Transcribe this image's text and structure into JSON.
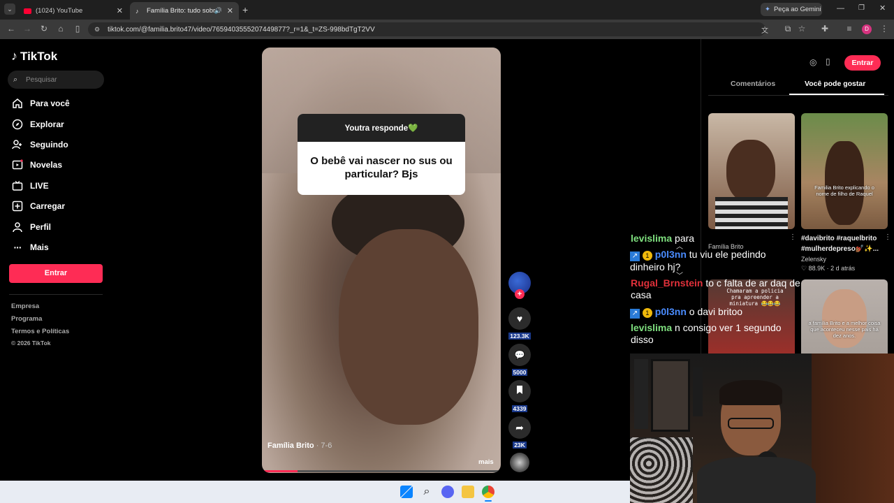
{
  "browser": {
    "tabs": [
      {
        "label": "(1024) YouTube"
      },
      {
        "label": "Família Brito: tudo sobre Ra"
      }
    ],
    "gemini_label": "Peça ao Gemini",
    "url": "tiktok.com/@familia.brito47/video/7659403555207449877?_r=1&_t=ZS-998bdTgT2VV",
    "profile_letter": "D"
  },
  "sidebar": {
    "logo": "TikTok",
    "search_placeholder": "Pesquisar",
    "items": [
      {
        "label": "Para você",
        "icon": "home-icon"
      },
      {
        "label": "Explorar",
        "icon": "compass-icon"
      },
      {
        "label": "Seguindo",
        "icon": "following-icon"
      },
      {
        "label": "Novelas",
        "icon": "novelas-icon"
      },
      {
        "label": "LIVE",
        "icon": "live-icon"
      },
      {
        "label": "Carregar",
        "icon": "upload-icon"
      },
      {
        "label": "Perfil",
        "icon": "profile-icon"
      },
      {
        "label": "Mais",
        "icon": "more-icon"
      }
    ],
    "login_button": "Entrar",
    "footer": [
      "Empresa",
      "Programa",
      "Termos e Políticas",
      "© 2026 TikTok"
    ]
  },
  "video": {
    "question_header": "Youtra responde💚",
    "question_text": "O bebê vai nascer no sus ou particular? Bjs",
    "author": "Família Brito",
    "date": "· 7-6",
    "more": "mais",
    "progress": 0.15
  },
  "actions": {
    "likes": "123.3K",
    "comments": "5000",
    "saves": "4339",
    "shares": "23K"
  },
  "right_panel": {
    "login_button": "Entrar",
    "tabs": [
      "Comentários",
      "Você pode gostar"
    ],
    "cards": [
      {
        "author": "Família Brito"
      },
      {
        "overlay": "Familia Brito explicando o nome de filho de Raquel",
        "title": "#davibrito #raquelbrito #mulherdepreso💅🏾✨...",
        "author": "Zelensky",
        "likes": "88.9K",
        "time": "2 d atrás"
      },
      {
        "overlay": "Chamaram a policia pra apreender a miniatura 😂😂😂"
      },
      {
        "overlay": "a família Brito e a melhor coisa que aconteceu nesse pais há dez anos."
      }
    ]
  },
  "chat": [
    {
      "user": "levislima",
      "text": "para",
      "color": "#7fe07f"
    },
    {
      "user": "p0l3nn",
      "text": "tu viu ele pedindo dinheiro hj?",
      "color": "#4a8cff"
    },
    {
      "user": "Rugal_Brnstein",
      "text": "to c falta de ar daq de casa",
      "color": "#e0303a"
    },
    {
      "user": "p0l3nn",
      "text": "o davi britoo",
      "color": "#4a8cff"
    },
    {
      "user": "levislima",
      "text": "n consigo ver 1 segundo disso",
      "color": "#7fe07f"
    }
  ],
  "colors": {
    "brand_red": "#fe2c55",
    "background": "#000000"
  }
}
